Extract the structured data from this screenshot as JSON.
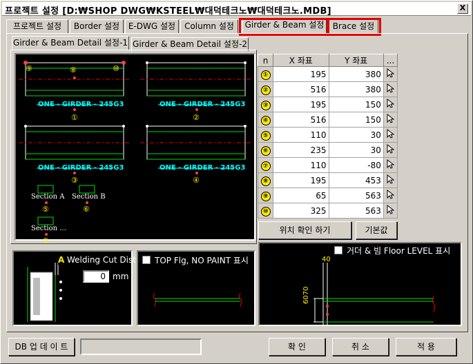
{
  "window": {
    "title": "프로젝트 설정   [D:₩SHOP DWG₩KSTEEL₩대덕테크노₩대덕테크노.MDB]",
    "close_label": "X"
  },
  "tabs": [
    {
      "label": "프로젝트 설정"
    },
    {
      "label": "Border 설정"
    },
    {
      "label": "E-DWG 설정"
    },
    {
      "label": "Column 설정"
    },
    {
      "label": "Girder & Beam 설정"
    },
    {
      "label": "Brace 설정"
    }
  ],
  "subtabs": [
    {
      "label": "Girder & Beam Detail 설정-1"
    },
    {
      "label": "Girder & Beam Detail 설정-2"
    }
  ],
  "preview": {
    "girder_label": "ONE - GIRDER - 245G3",
    "markers": [
      "⑨",
      "⑧",
      "⑩",
      "①",
      "②",
      "③",
      "④",
      "⑤",
      "⑥",
      "⑦"
    ],
    "section_a": "Section A",
    "section_b": "Section B",
    "section_more": "Section ..."
  },
  "table": {
    "headers": [
      "n",
      "X 좌표",
      "Y 좌표",
      "..."
    ],
    "rows": [
      {
        "n": "①",
        "x": "195",
        "y": "380"
      },
      {
        "n": "②",
        "x": "516",
        "y": "380"
      },
      {
        "n": "③",
        "x": "195",
        "y": "150"
      },
      {
        "n": "④",
        "x": "516",
        "y": "150"
      },
      {
        "n": "⑤",
        "x": "110",
        "y": "30"
      },
      {
        "n": "⑥",
        "x": "235",
        "y": "30"
      },
      {
        "n": "⑦",
        "x": "110",
        "y": "-80"
      },
      {
        "n": "⑧",
        "x": "195",
        "y": "453"
      },
      {
        "n": "⑨",
        "x": "65",
        "y": "563"
      },
      {
        "n": "⑩",
        "x": "325",
        "y": "563"
      }
    ]
  },
  "buttons": {
    "check_position": "위치 확인 하기",
    "default": "기본값",
    "db_update": "DB 업 데 이 트",
    "ok": "확  인",
    "cancel": "취  소",
    "apply": "적  용"
  },
  "welding": {
    "marker": "A",
    "label": "Welding Cut Dist",
    "value": "0",
    "unit": "mm"
  },
  "top_flg": {
    "label": "TOP Flg, NO PAINT 표시"
  },
  "floor_level": {
    "label": "거더 & 빔 Floor LEVEL 표시",
    "dim_top": "40",
    "dim_side": "6070"
  }
}
